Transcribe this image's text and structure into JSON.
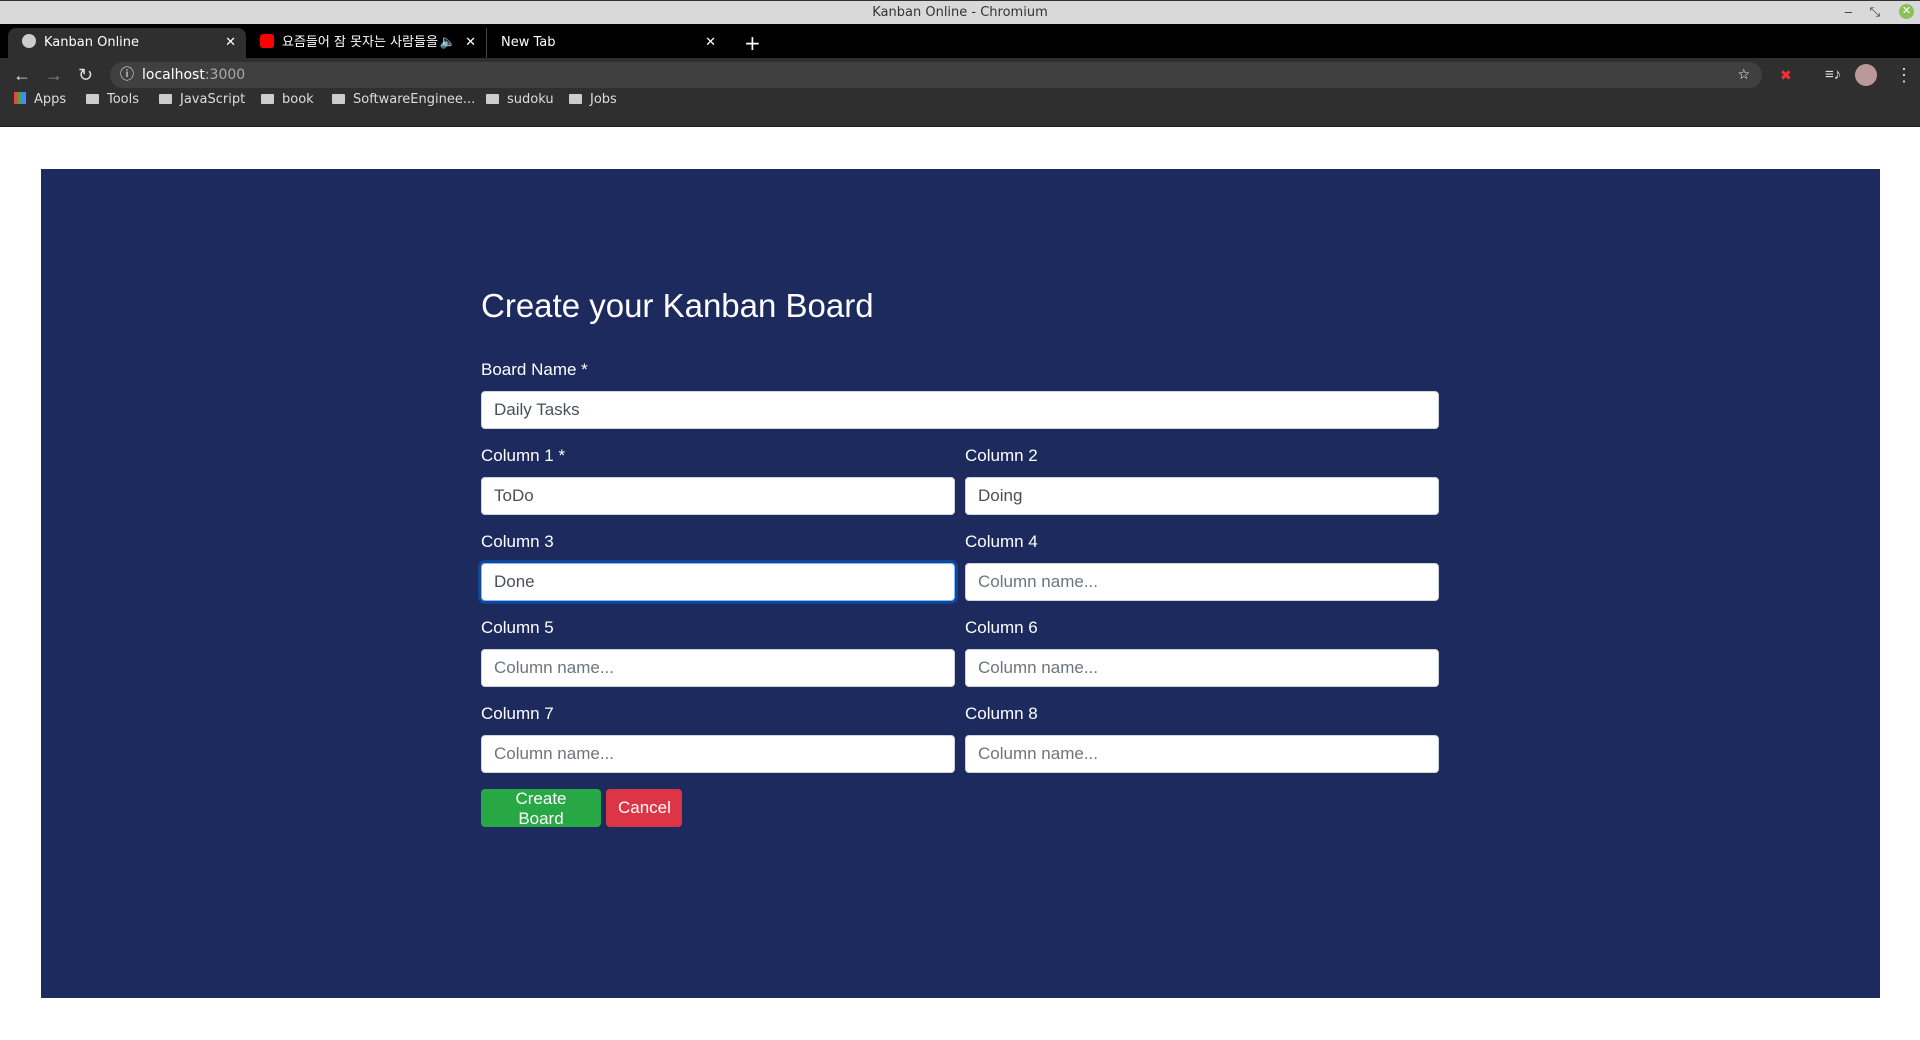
{
  "window": {
    "title": "Kanban Online - Chromium"
  },
  "tabs": [
    {
      "label": "Kanban Online",
      "active": true
    },
    {
      "label": "요즘들어 잠 못자는 사람들을",
      "audio": true
    },
    {
      "label": "New Tab"
    }
  ],
  "address": {
    "host": "localhost",
    "port": ":3000"
  },
  "bookmarks": [
    "Apps",
    "Tools",
    "JavaScript",
    "book",
    "SoftwareEnginee...",
    "sudoku",
    "Jobs"
  ],
  "form": {
    "title": "Create your Kanban Board",
    "board_name_label": "Board Name *",
    "board_name_value": "Daily Tasks",
    "placeholder": "Column name...",
    "columns": [
      {
        "label": "Column 1 *",
        "value": "ToDo"
      },
      {
        "label": "Column 2",
        "value": "Doing"
      },
      {
        "label": "Column 3",
        "value": "Done"
      },
      {
        "label": "Column 4",
        "value": ""
      },
      {
        "label": "Column 5",
        "value": ""
      },
      {
        "label": "Column 6",
        "value": ""
      },
      {
        "label": "Column 7",
        "value": ""
      },
      {
        "label": "Column 8",
        "value": ""
      }
    ],
    "create_label": "Create Board",
    "cancel_label": "Cancel"
  },
  "colors": {
    "panel": "#1c2a5e",
    "create": "#28a745",
    "cancel": "#dc3545"
  }
}
